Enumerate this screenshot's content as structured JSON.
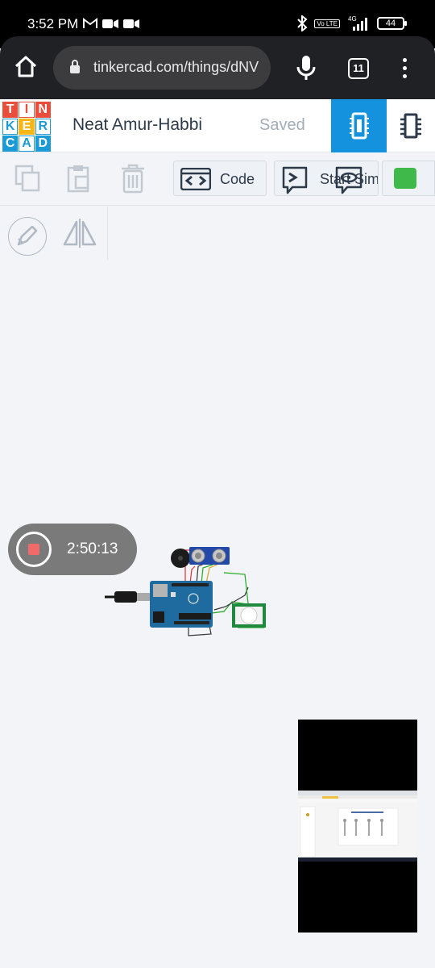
{
  "status_bar": {
    "time": "3:52 PM",
    "network": "4G",
    "lte_badge": "Vo LTE",
    "battery": "44"
  },
  "browser": {
    "url": "tinkercad.com/things/dNV",
    "tab_count": "11"
  },
  "header": {
    "logo_letters": [
      "T",
      "I",
      "N",
      "K",
      "E",
      "R",
      "C",
      "A",
      "D"
    ],
    "design_title": "Neat Amur-Habbi",
    "saved_label": "Saved"
  },
  "toolbar": {
    "code_label": "Code",
    "start_simulation_label": "Start Simulation"
  },
  "recording": {
    "elapsed": "2:50:13"
  },
  "colors": {
    "accent_blue": "#1592dd",
    "sim_green": "#3fb94a",
    "record_red": "#f06a6a"
  }
}
